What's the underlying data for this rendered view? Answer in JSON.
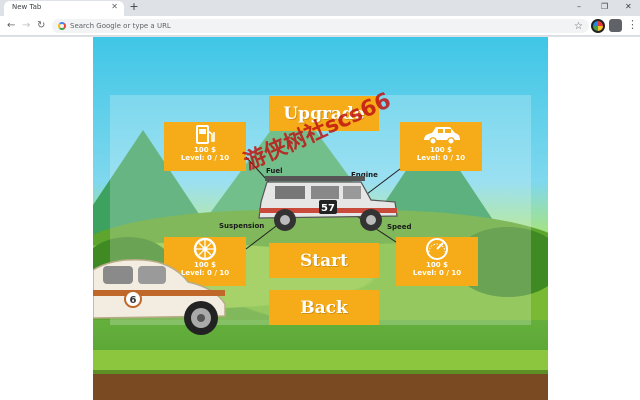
{
  "browser": {
    "tab_title": "New Tab",
    "tab_close": "✕",
    "new_tab": "+",
    "window_buttons": {
      "minimize": "–",
      "restore": "❐",
      "close": "✕"
    },
    "nav": {
      "back": "←",
      "forward": "→",
      "reload": "↻"
    },
    "omnibox_placeholder": "Search Google or type a URL",
    "star": "☆",
    "menu": "⋮"
  },
  "game": {
    "upgrade_label": "Upgrade",
    "start_label": "Start",
    "back_label": "Back",
    "watermark": "游侠树社scs66",
    "parts": {
      "fuel": {
        "icon": "fuel-pump-icon",
        "price": "100 $",
        "level": "Level: 0 / 10"
      },
      "engine": {
        "icon": "car-body-icon",
        "price": "100 $",
        "level": "Level: 0 / 10"
      },
      "suspension": {
        "icon": "wheel-icon",
        "price": "100 $",
        "level": "Level: 0 / 10"
      },
      "speed": {
        "icon": "speedometer-icon",
        "price": "100 $",
        "level": "Level: 0 / 10"
      }
    },
    "callouts": {
      "fuel": "Fuel",
      "engine": "Engine",
      "suspension": "Suspension",
      "speed": "Speed"
    },
    "car_number": "57",
    "parked_car_number": "6",
    "colors": {
      "button": "#f6ab18",
      "sky": "#3fc6e6",
      "grass": "#8cc63f",
      "dirt": "#7a4a22"
    }
  }
}
